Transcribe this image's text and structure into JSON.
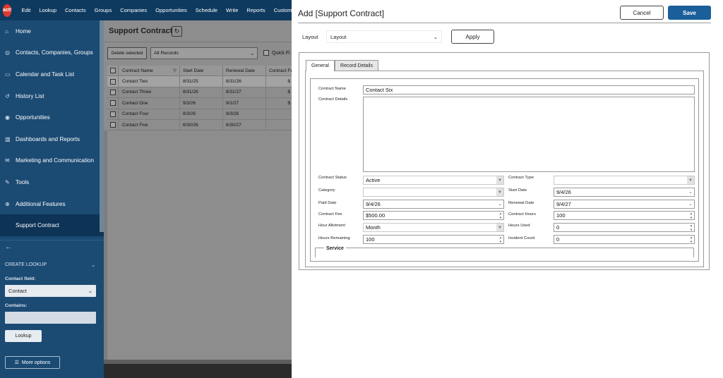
{
  "app": {
    "logo": "act!",
    "menu": [
      "Edit",
      "Lookup",
      "Contacts",
      "Groups",
      "Companies",
      "Opportunities",
      "Schedule",
      "Write",
      "Reports",
      "Custom"
    ]
  },
  "sidebar": {
    "items": [
      {
        "label": "Home",
        "icon": "home-icon"
      },
      {
        "label": "Contacts, Companies, Groups",
        "icon": "contacts-icon"
      },
      {
        "label": "Calendar and Task List",
        "icon": "calendar-icon"
      },
      {
        "label": "History List",
        "icon": "history-icon"
      },
      {
        "label": "Opportunities",
        "icon": "opportunities-icon"
      },
      {
        "label": "Dashboards and Reports",
        "icon": "chart-icon"
      },
      {
        "label": "Marketing and Communication",
        "icon": "mail-icon"
      },
      {
        "label": "Tools",
        "icon": "wrench-icon"
      },
      {
        "label": "Additional Features",
        "icon": "plus-icon"
      },
      {
        "label": "Support Contract",
        "icon": ""
      }
    ],
    "create_lookup": "CREATE LOOKUP",
    "contact_field_label": "Contact field:",
    "contact_field_value": "Contact",
    "contains_label": "Contains:",
    "lookup_button": "Lookup",
    "more_options": "More options"
  },
  "list": {
    "title": "Support Contract",
    "delete_selected": "Delete selected",
    "records_filter": "All Records",
    "quick_filter": "Quick Fi",
    "columns": [
      "Contract Name",
      "Start Date",
      "Renewal Date",
      "Contract Fe"
    ],
    "rows": [
      {
        "name": "Contact Two",
        "start": "8/31/25",
        "renewal": "8/31/26",
        "fee": "$"
      },
      {
        "name": "Contact Three",
        "start": "8/31/26",
        "renewal": "8/31/27",
        "fee": "$"
      },
      {
        "name": "Contact One",
        "start": "9/3/26",
        "renewal": "9/1/27",
        "fee": "$"
      },
      {
        "name": "Contact Four",
        "start": "8/3/26",
        "renewal": "8/3/26",
        "fee": ""
      },
      {
        "name": "Contact Five",
        "start": "6/30/26",
        "renewal": "6/30/27",
        "fee": ""
      }
    ]
  },
  "modal": {
    "title": "Add [Support Contract]",
    "cancel": "Cancel",
    "save": "Save",
    "layout_label": "Layout",
    "layout_value": "Layout",
    "apply": "Apply",
    "tabs": [
      "General",
      "Record Details"
    ],
    "fields": {
      "contract_name": {
        "label": "Contract Name",
        "value": "Contact Six"
      },
      "contract_details": {
        "label": "Contract Details",
        "value": ""
      },
      "contract_status": {
        "label": "Contract Status",
        "value": "Active"
      },
      "contract_type": {
        "label": "Contract Type",
        "value": ""
      },
      "category": {
        "label": "Category",
        "value": ""
      },
      "start_date": {
        "label": "Start Date",
        "value": "9/4/26"
      },
      "paid_date": {
        "label": "Paid Date",
        "value": "9/4/26"
      },
      "renewal_date": {
        "label": "Renewal Date",
        "value": "9/4/27"
      },
      "contract_fee": {
        "label": "Contract Fee",
        "value": "$500.00"
      },
      "contract_hours": {
        "label": "Contract Hours",
        "value": "100"
      },
      "hour_allotment": {
        "label": "Hour Allotment",
        "value": "Month"
      },
      "hours_used": {
        "label": "Hours Used",
        "value": "0"
      },
      "hours_remaining": {
        "label": "Hours Remaining",
        "value": "100"
      },
      "incident_count": {
        "label": "Incident Count",
        "value": "0"
      }
    },
    "service_label": "Service"
  }
}
